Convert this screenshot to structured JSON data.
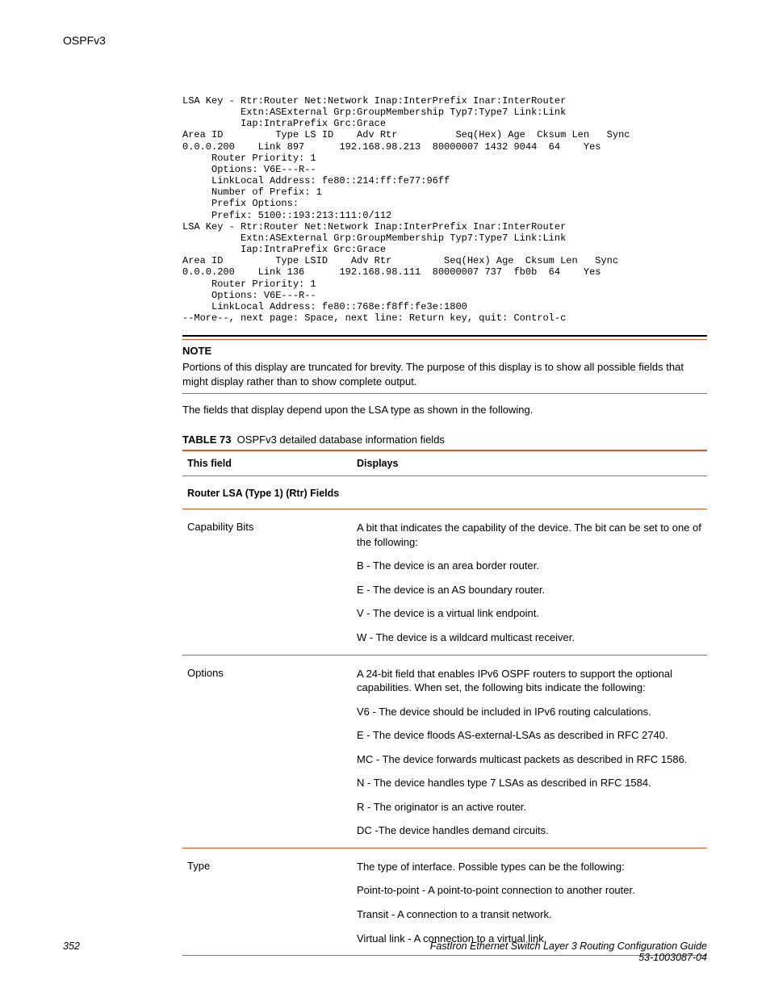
{
  "header": {
    "title": "OSPFv3"
  },
  "code_output": "LSA Key - Rtr:Router Net:Network Inap:InterPrefix Inar:InterRouter\n          Extn:ASExternal Grp:GroupMembership Typ7:Type7 Link:Link\n          Iap:IntraPrefix Grc:Grace\nArea ID         Type LS ID    Adv Rtr          Seq(Hex) Age  Cksum Len   Sync\n0.0.0.200    Link 897      192.168.98.213  80000007 1432 9044  64    Yes \n     Router Priority: 1\n     Options: V6E---R--\n     LinkLocal Address: fe80::214:ff:fe77:96ff\n     Number of Prefix: 1\n     Prefix Options: \n     Prefix: 5100::193:213:111:0/112\nLSA Key - Rtr:Router Net:Network Inap:InterPrefix Inar:InterRouter\n          Extn:ASExternal Grp:GroupMembership Typ7:Type7 Link:Link\n          Iap:IntraPrefix Grc:Grace\nArea ID         Type LSID    Adv Rtr         Seq(Hex) Age  Cksum Len   Sync\n0.0.0.200    Link 136      192.168.98.111  80000007 737  fb0b  64    Yes \n     Router Priority: 1\n     Options: V6E---R--\n     LinkLocal Address: fe80::768e:f8ff:fe3e:1800\n--More--, next page: Space, next line: Return key, quit: Control-c",
  "note": {
    "heading": "NOTE",
    "body": "Portions of this display are truncated for brevity. The purpose of this display is to show all possible fields that might display rather than to show complete output."
  },
  "intro_para": "The fields that display depend upon the LSA type as shown in the following.",
  "table": {
    "caption_label": "TABLE 73",
    "caption_text": "OSPFv3 detailed database information fields",
    "head": {
      "col1": "This field",
      "col2": "Displays"
    },
    "section1": "Router LSA (Type 1) (Rtr) Fields",
    "rows": [
      {
        "field": "Capability Bits",
        "paras": [
          "A bit that indicates the capability of the device. The bit can be set to one of the following:",
          "B - The device is an area border router.",
          "E - The device is an AS boundary router.",
          "V - The device is a virtual link endpoint.",
          "W - The device is a wildcard multicast receiver."
        ]
      },
      {
        "field": "Options",
        "paras": [
          "A 24-bit field that enables IPv6 OSPF routers to support the optional capabilities. When set, the following bits indicate the following:",
          "V6 - The device should be included in IPv6 routing calculations.",
          "E - The device floods AS-external-LSAs as described in RFC 2740.",
          "MC - The device forwards multicast packets as described in RFC 1586.",
          "N - The device handles type 7 LSAs as described in RFC 1584.",
          "R - The originator is an active router.",
          "DC -The device handles demand circuits."
        ]
      },
      {
        "field": "Type",
        "paras": [
          "The type of interface. Possible types can be the following:",
          "Point-to-point - A point-to-point connection to another router.",
          "Transit - A connection to a transit network.",
          "Virtual link - A connection to a virtual link."
        ]
      }
    ]
  },
  "footer": {
    "page": "352",
    "title": "FastIron Ethernet Switch Layer 3 Routing Configuration Guide",
    "docnum": "53-1003087-04"
  }
}
